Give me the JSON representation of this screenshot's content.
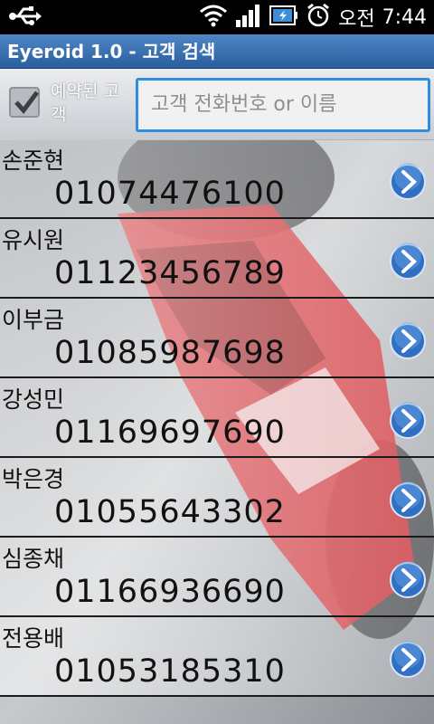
{
  "status_bar": {
    "ampm": "오전",
    "time": "7:44",
    "icons": [
      "usb-icon",
      "wifi-icon",
      "signal-icon",
      "battery-icon",
      "alarm-icon"
    ]
  },
  "app": {
    "title": "Eyeroid 1.0 - 고객 검색"
  },
  "search": {
    "checkbox_label": "예약된 고객",
    "checked": true,
    "placeholder": "고객 전화번호 or 이름",
    "value": ""
  },
  "customers": [
    {
      "name": "손준현",
      "phone": "01074476100"
    },
    {
      "name": "유시원",
      "phone": "01123456789"
    },
    {
      "name": "이부금",
      "phone": "01085987698"
    },
    {
      "name": "강성민",
      "phone": "01169697690"
    },
    {
      "name": "박은경",
      "phone": "01055643302"
    },
    {
      "name": "심종채",
      "phone": "01166936690"
    },
    {
      "name": "전용배",
      "phone": "01053185310"
    }
  ],
  "colors": {
    "accent": "#2f8de0",
    "titlebar": "#3a70b0",
    "arrow": "#2f6fc4"
  }
}
